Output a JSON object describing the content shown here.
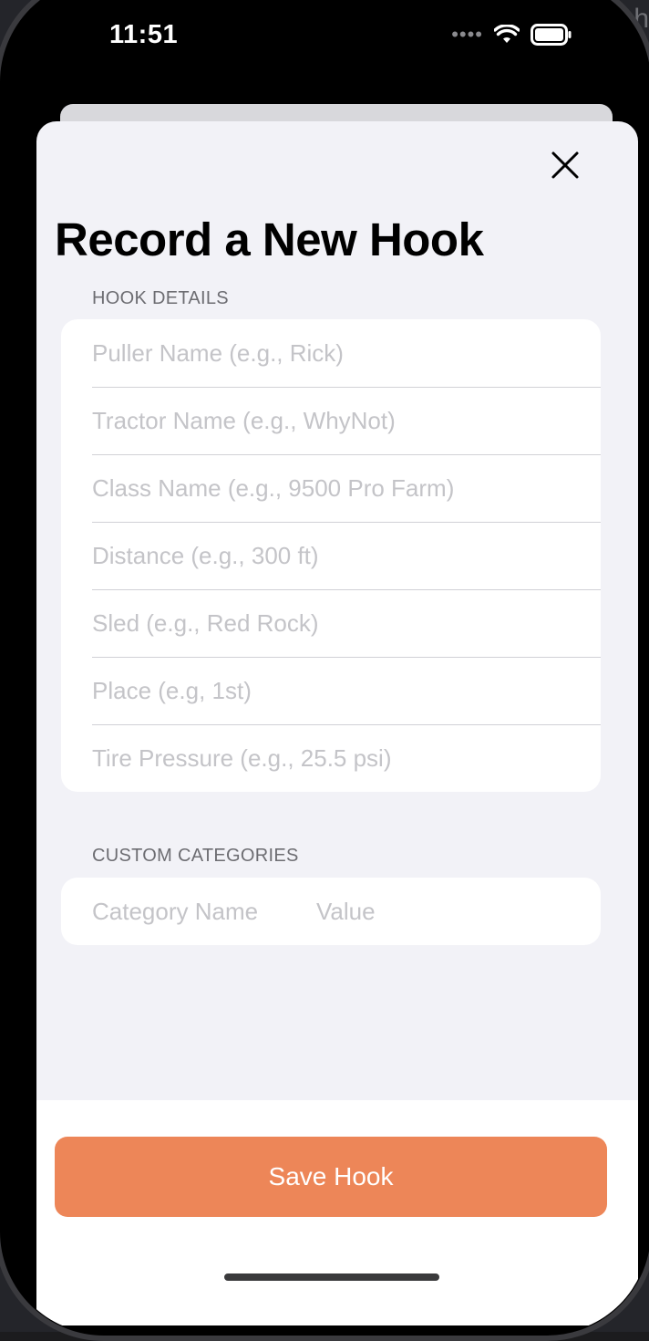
{
  "backdrop": {
    "edge_text": "ch"
  },
  "status_bar": {
    "time": "11:51"
  },
  "sheet": {
    "title": "Record a New Hook",
    "close_icon": "close-icon"
  },
  "hook_details": {
    "section_label": "HOOK DETAILS",
    "fields": [
      {
        "placeholder": "Puller Name (e.g., Rick)",
        "value": ""
      },
      {
        "placeholder": "Tractor Name (e.g., WhyNot)",
        "value": ""
      },
      {
        "placeholder": "Class Name (e.g., 9500 Pro Farm)",
        "value": ""
      },
      {
        "placeholder": "Distance (e.g., 300 ft)",
        "value": ""
      },
      {
        "placeholder": "Sled (e.g., Red Rock)",
        "value": ""
      },
      {
        "placeholder": "Place (e.g, 1st)",
        "value": ""
      },
      {
        "placeholder": "Tire Pressure (e.g., 25.5 psi)",
        "value": ""
      }
    ]
  },
  "custom_categories": {
    "section_label": "CUSTOM CATEGORIES",
    "name_placeholder": "Category Name",
    "value_placeholder": "Value",
    "add_icon": "plus-circle-icon"
  },
  "footer": {
    "save_label": "Save Hook"
  },
  "colors": {
    "accent_orange": "#ed8658",
    "add_blue": "#3478f6",
    "sheet_bg": "#f2f2f7"
  }
}
